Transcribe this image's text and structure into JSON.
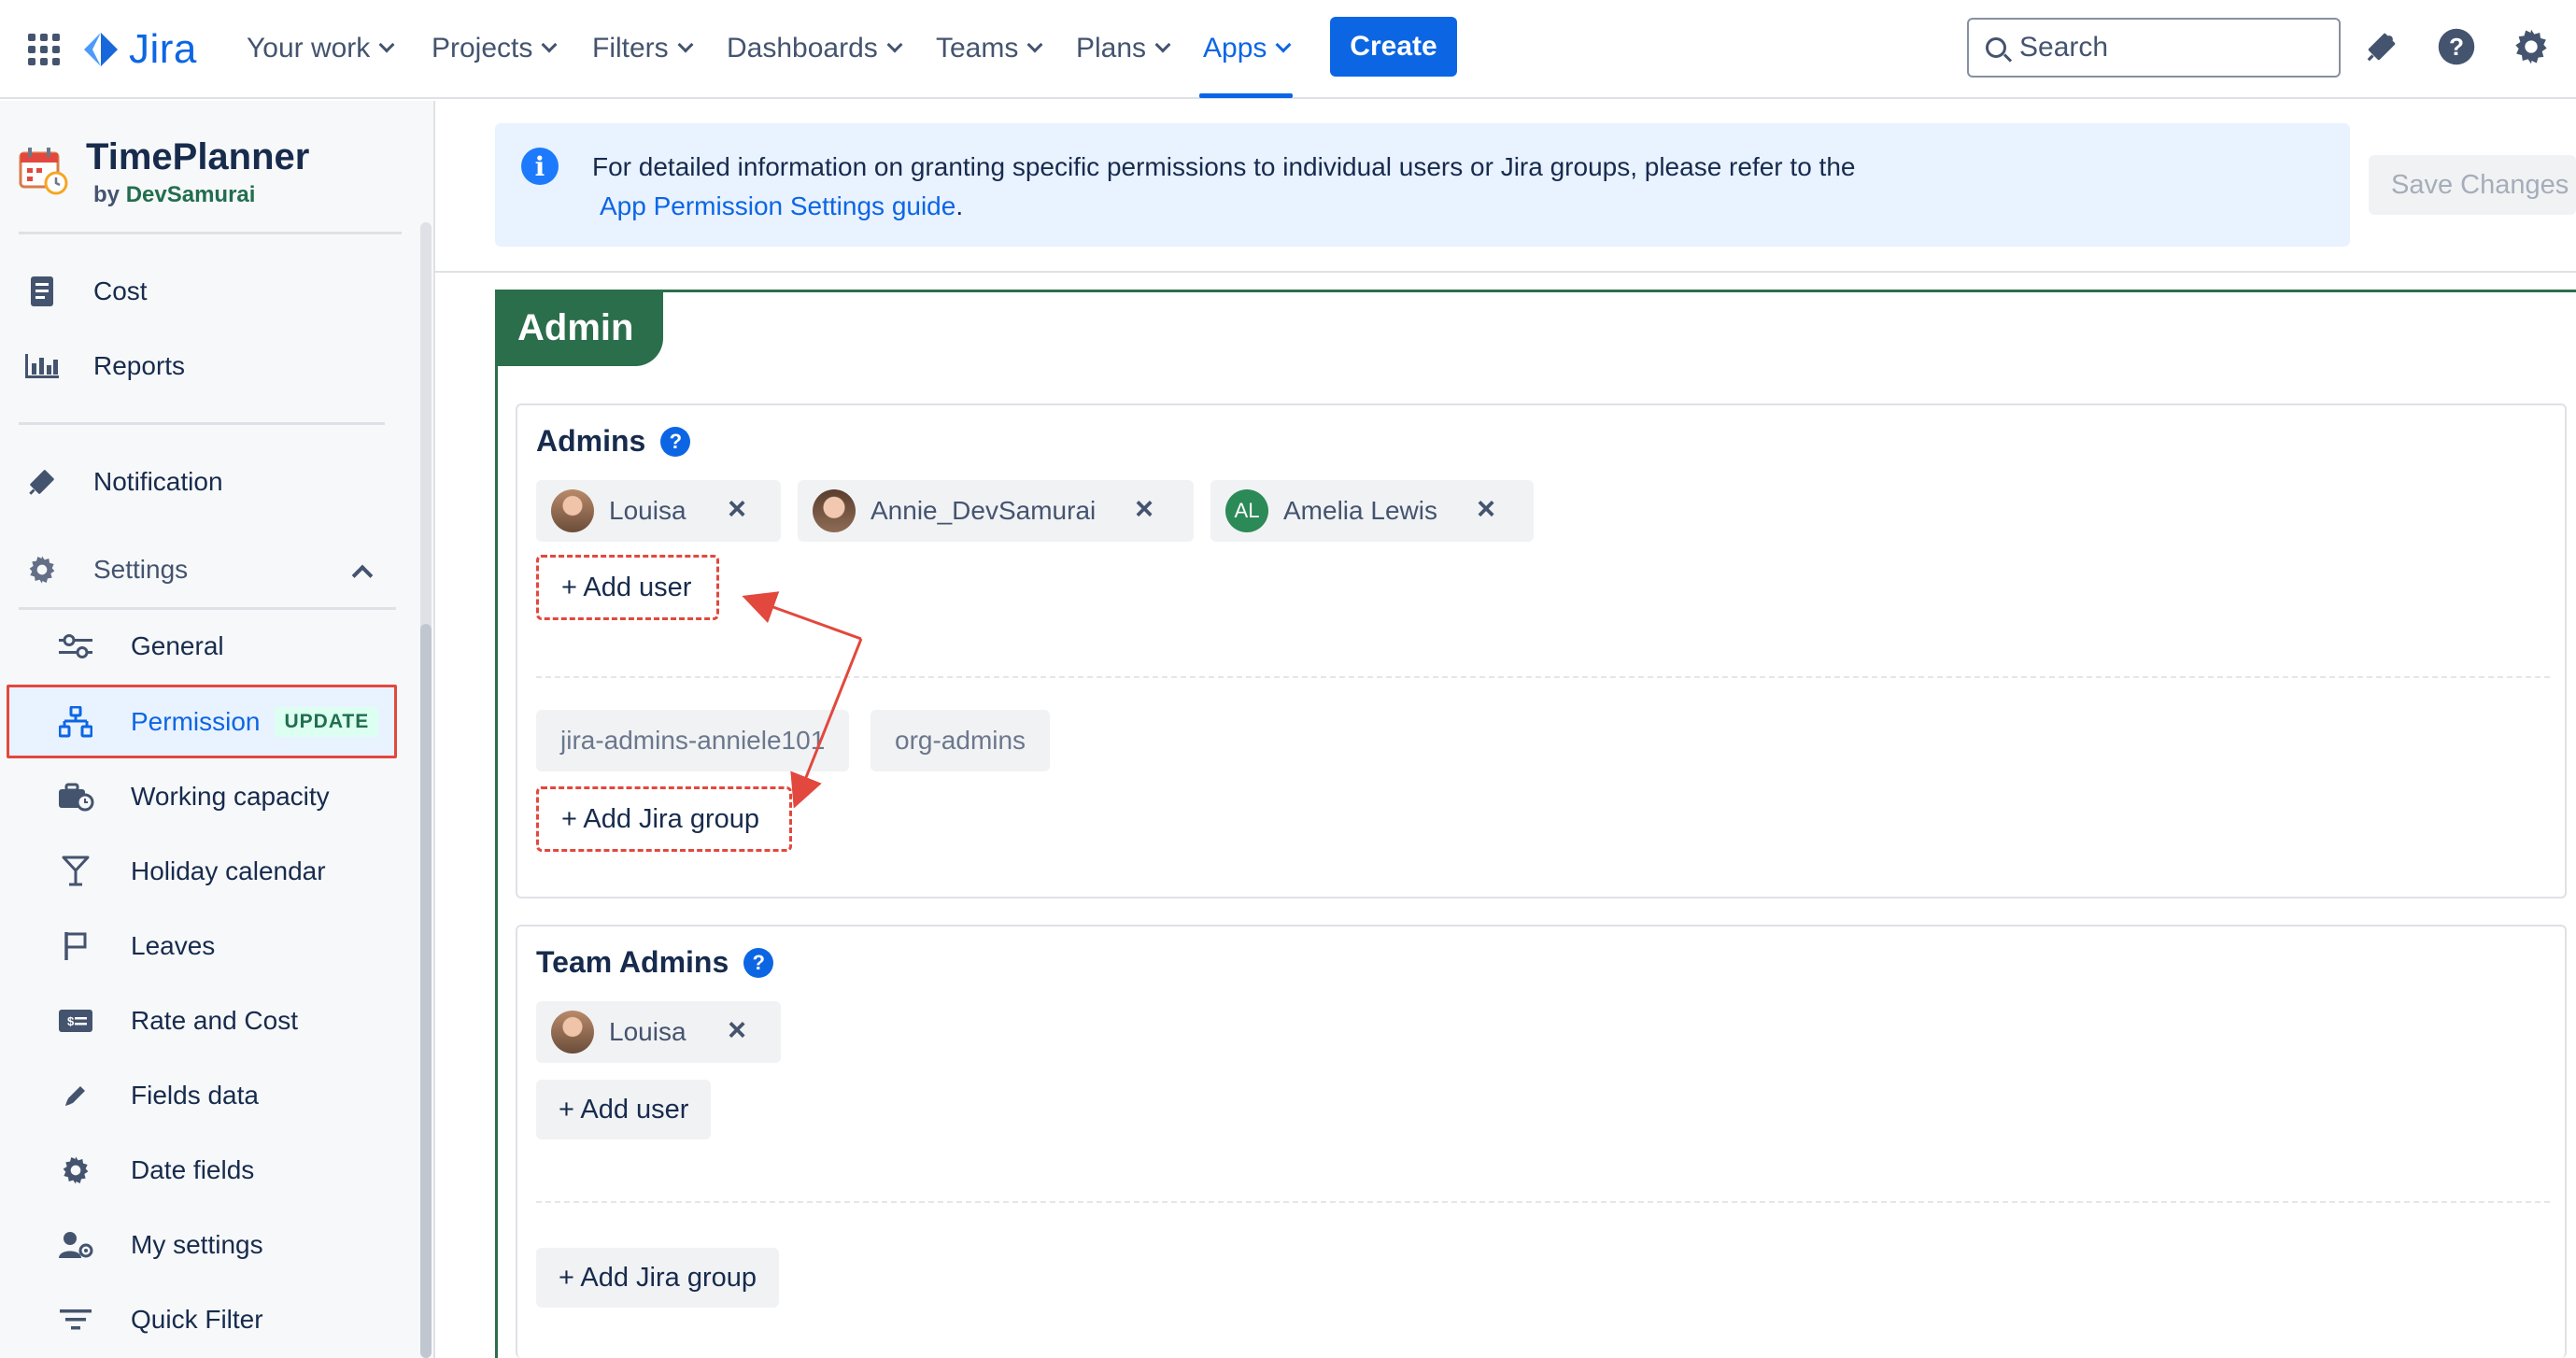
{
  "topnav": {
    "logo_text": "Jira",
    "items": [
      {
        "label": "Your work"
      },
      {
        "label": "Projects"
      },
      {
        "label": "Filters"
      },
      {
        "label": "Dashboards"
      },
      {
        "label": "Teams"
      },
      {
        "label": "Plans"
      },
      {
        "label": "Apps",
        "active": true
      }
    ],
    "create_label": "Create",
    "search_placeholder": "Search",
    "icons": [
      "app-switcher-icon",
      "notifications-icon",
      "help-icon",
      "settings-icon"
    ]
  },
  "sidebar": {
    "brand_title": "TimePlanner",
    "brand_by": "by",
    "brand_author": "DevSamurai",
    "top_items": [
      {
        "label": "Cost",
        "icon": "document-icon"
      },
      {
        "label": "Reports",
        "icon": "bar-chart-icon"
      }
    ],
    "notification_label": "Notification",
    "settings_label": "Settings",
    "settings_items": [
      {
        "label": "General",
        "icon": "sliders-icon"
      },
      {
        "label": "Permission",
        "icon": "hierarchy-icon",
        "badge": "UPDATE",
        "selected": true
      },
      {
        "label": "Working capacity",
        "icon": "briefcase-clock-icon"
      },
      {
        "label": "Holiday calendar",
        "icon": "glass-icon"
      },
      {
        "label": "Leaves",
        "icon": "flag-icon"
      },
      {
        "label": "Rate and Cost",
        "icon": "money-card-icon"
      },
      {
        "label": "Fields data",
        "icon": "pencil-icon"
      },
      {
        "label": "Date fields",
        "icon": "gear-icon"
      },
      {
        "label": "My settings",
        "icon": "user-gear-icon"
      },
      {
        "label": "Quick Filter",
        "icon": "filter-icon"
      }
    ]
  },
  "info_banner": {
    "text": "For detailed information on granting specific permissions to individual users or Jira groups, please refer to the",
    "link": "App Permission Settings guide",
    "link_suffix": "."
  },
  "save_label": "Save Changes",
  "admin_section": {
    "tab_label": "Admin",
    "admins": {
      "title": "Admins",
      "users": [
        {
          "name": "Louisa",
          "avatar": "photo"
        },
        {
          "name": "Annie_DevSamurai",
          "avatar": "photo"
        },
        {
          "name": "Amelia Lewis",
          "avatar": "initials",
          "initials": "AL"
        }
      ],
      "add_user_label": "+ Add user",
      "groups": [
        "jira-admins-anniele101",
        "org-admins"
      ],
      "add_group_label": "+ Add Jira group"
    },
    "team_admins": {
      "title": "Team Admins",
      "users": [
        {
          "name": "Louisa",
          "avatar": "photo"
        }
      ],
      "add_user_label": "+ Add user",
      "add_group_label": "+ Add Jira group"
    }
  },
  "colors": {
    "brand_blue": "#0c66e4",
    "admin_green": "#2b6e4b",
    "annotation_red": "#e2483d"
  }
}
